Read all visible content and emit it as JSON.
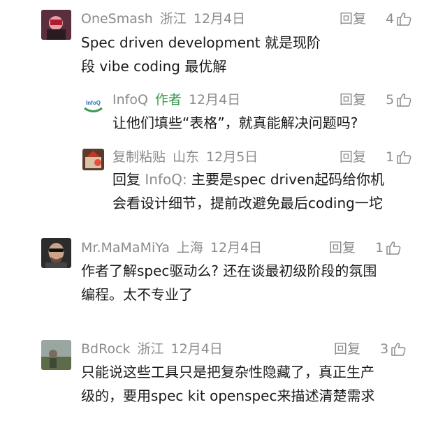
{
  "comments": [
    {
      "author": "OneSmash",
      "location": "浙江",
      "date": "12月4日",
      "reply_label": "回复",
      "likes": "4",
      "lines": [
        "Spec driven development 就是现阶",
        "段 vibe coding 最优解"
      ],
      "replies": [
        {
          "author": "InfoQ",
          "author_tag": "作者",
          "date": "12月4日",
          "reply_label": "回复",
          "likes": "5",
          "avatar_text": "InfoQ",
          "lines": [
            "让他们填些“表格”，就真能解决问题吗?"
          ]
        },
        {
          "author": "复制粘贴",
          "location": "山东",
          "date": "12月5日",
          "reply_label": "回复",
          "likes": "1",
          "reply_prefix": "回复 ",
          "reply_target": "InfoQ:",
          "lines": [
            " 主要是spec driven起码给你机",
            "会看设计细节，提前改避免最后coding一坨"
          ]
        }
      ]
    },
    {
      "author": "Mr.MaMaMiYa",
      "location": "上海",
      "date": "12月4日",
      "reply_label": "回复",
      "likes": "1",
      "lines": [
        "作者了解spec驱动么? 还在谈最初级阶段的氛围",
        "编程。太不专业了"
      ]
    },
    {
      "author": "BdRock",
      "location": "浙江",
      "date": "12月4日",
      "reply_label": "回复",
      "likes": "3",
      "lines": [
        "只能说这些工具只是把复杂性隐藏了，真正生产",
        "级的，要用spec kit openspec来描述清楚需求"
      ]
    }
  ],
  "colors": {
    "meta": "#8c8c8c",
    "text": "#1a1a1a",
    "author_tag": "#3d9a4e"
  },
  "icons": {
    "like": "thumbs-up-icon"
  }
}
